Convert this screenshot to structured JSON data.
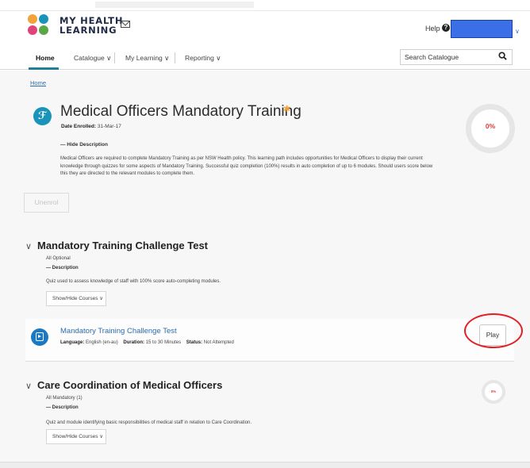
{
  "brand": {
    "name_line1": "MY HEALTH",
    "name_line2": "LEARNING",
    "logo_colors": [
      "#f2a33a",
      "#1a93b8",
      "#e0427a",
      "#5aa845"
    ]
  },
  "header": {
    "help_label": "Help",
    "help_icon": "question-circle-icon",
    "user_box_color": "#3a6fe8",
    "mail_icon": "mail-icon"
  },
  "nav": {
    "items": [
      {
        "label": "Home",
        "active": true
      },
      {
        "label": "Catalogue ∨",
        "active": false
      },
      {
        "label": "My Learning ∨",
        "active": false
      },
      {
        "label": "Reporting ∨",
        "active": false
      }
    ],
    "search_placeholder": "Search Catalogue",
    "accent_color": "#1f7f99"
  },
  "breadcrumb": "Home",
  "learning_path": {
    "title": "Medical Officers Mandatory Training",
    "favorite_icon": "star-icon",
    "date_enrolled_label": "Date Enrolled:",
    "date_enrolled_value": "31-Mar-17",
    "hide_description_label": "—  Hide Description",
    "description": "Medical Officers are required to complete Mandatory Training as per NSW Health policy. This learning path includes opportunities for Medical Officers to display their current knowledge through quizzes for some aspects of Mandatory Training. Successful quiz completion (100%) results in auto completion of up to 6 modules. Should users score below this they are directed to the relevant modules to complete them.",
    "progress_label": "0%",
    "progress_fraction": 0,
    "unenrol_label": "Unenrol"
  },
  "sections": [
    {
      "title": "Mandatory Training Challenge Test",
      "requirement": "All Optional",
      "description_toggle": "—  Description",
      "description": "Quiz used to assess knowledge of staff with 100% score auto-completing modules.",
      "show_hide_label": "Show/Hide Courses ∨",
      "course": {
        "title": "Mandatory Training Challenge Test",
        "language_label": "Language:",
        "language_value": "English (en-au)",
        "duration_label": "Duration:",
        "duration_value": "15 to 30 Minutes",
        "status_label": "Status:",
        "status_value": "Not Attempted",
        "play_label": "Play"
      }
    },
    {
      "title": "Care Coordination of Medical Officers",
      "requirement": "All Mandatory (1)",
      "description_toggle": "—  Description",
      "description": "Quiz and module identifying basic responsibilities of medical staff in relation to Care Coordination.",
      "show_hide_label": "Show/Hide Courses ∨",
      "progress_label": "0%",
      "progress_fraction": 0
    }
  ],
  "annotation_color": "#e21f26"
}
